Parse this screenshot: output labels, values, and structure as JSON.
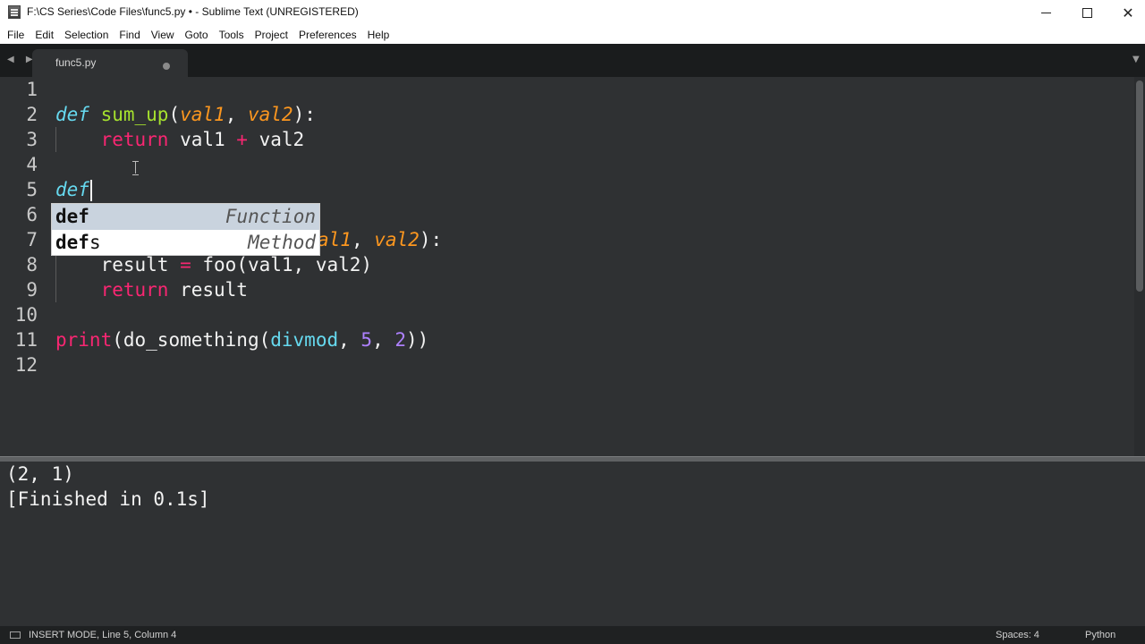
{
  "window": {
    "title": "F:\\CS Series\\Code Files\\func5.py • - Sublime Text (UNREGISTERED)",
    "minimize": "minimize",
    "maximize": "maximize",
    "close": "✕"
  },
  "menu": [
    "File",
    "Edit",
    "Selection",
    "Find",
    "View",
    "Goto",
    "Tools",
    "Project",
    "Preferences",
    "Help"
  ],
  "tabs": {
    "nav": "◀ ▶",
    "active": {
      "label": "func5.py",
      "unsaved": true
    },
    "dropdown": "▼"
  },
  "editor": {
    "line_numbers": [
      "1",
      "2",
      "3",
      "4",
      "5",
      "6",
      "7",
      "8",
      "9",
      "10",
      "11",
      "12"
    ],
    "lines": {
      "l2": {
        "def": "def",
        "sp1": " ",
        "name": "sum_up",
        "open": "(",
        "p1": "val1",
        "comma": ", ",
        "p2": "val2",
        "close": "):"
      },
      "l3": {
        "indent": "    ",
        "ret": "return",
        "rest_a": " val1 ",
        "plus": "+",
        "rest_b": " val2"
      },
      "l5": {
        "typed": "def"
      },
      "l7": {
        "p1": "al1",
        "comma": ", ",
        "p2": "val2",
        "close": "):"
      },
      "l8": {
        "indent": "    ",
        "var": "result ",
        "eq": "=",
        "rest": " foo(val1, val2)"
      },
      "l9": {
        "indent": "    ",
        "ret": "return",
        "rest": " result"
      },
      "l11": {
        "print": "print",
        "open": "(",
        "call": "do_something(",
        "arg1": "divmod",
        "sep1": ", ",
        "n1": "5",
        "sep2": ", ",
        "n2": "2",
        "close": "))"
      }
    }
  },
  "autocomplete": [
    {
      "match": "def",
      "rest": "",
      "kind": "Function",
      "selected": true
    },
    {
      "match": "def",
      "rest": "s",
      "kind": "Method",
      "selected": false
    }
  ],
  "output": {
    "lines": [
      "(2, 1)",
      "[Finished in 0.1s]"
    ]
  },
  "statusbar": {
    "mode": "INSERT MODE, Line 5, Column 4",
    "spaces": "Spaces: 4",
    "syntax": "Python"
  }
}
